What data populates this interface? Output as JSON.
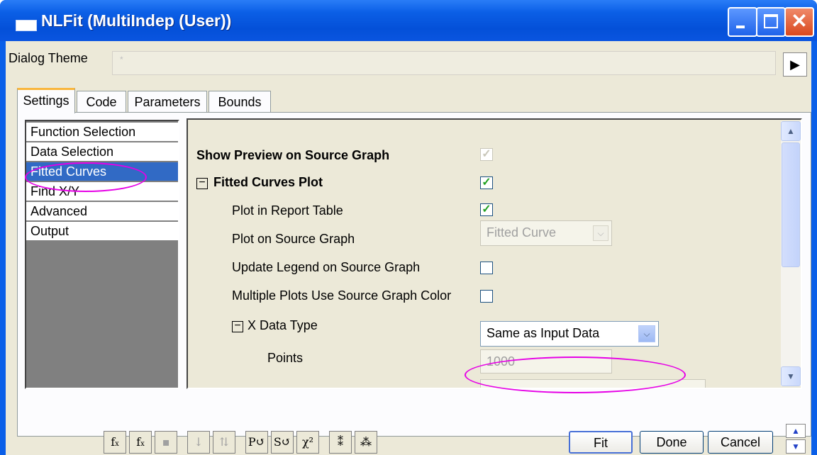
{
  "window": {
    "title": "NLFit (MultiIndep (User))"
  },
  "theme": {
    "label": "Dialog Theme",
    "value": "*"
  },
  "tabs": [
    "Settings",
    "Code",
    "Parameters",
    "Bounds"
  ],
  "nav": {
    "items": [
      "Function Selection",
      "Data Selection",
      "Fitted Curves",
      "Find X/Y",
      "Advanced",
      "Output"
    ],
    "selected": 2
  },
  "settings": {
    "show_preview": {
      "label": "Show Preview on Source Graph",
      "checked": true,
      "enabled": false
    },
    "fitted_curves_plot": {
      "label": "Fitted Curves Plot",
      "checked": true
    },
    "plot_in_report": {
      "label": "Plot in Report Table",
      "checked": true
    },
    "plot_on_source": {
      "label": "Plot on Source Graph",
      "value": "Fitted Curve"
    },
    "update_legend": {
      "label": "Update Legend on Source Graph",
      "checked": false
    },
    "multiple_plots": {
      "label": "Multiple Plots Use Source Graph Color",
      "checked": false
    },
    "x_data_type": {
      "label": "X Data Type",
      "value": "Same as Input Data"
    },
    "points": {
      "label": "Points",
      "value": "1000"
    }
  },
  "toolbar": {
    "icons": [
      "fit-function-icon",
      "function-icon",
      "save-icon",
      "sort-down-icon",
      "sort-params-icon",
      "p-arrow-icon",
      "s-arrow-icon",
      "chi-square-icon",
      "iterate-icon",
      "iterate-fast-icon"
    ],
    "chi": "χ²"
  },
  "buttons": {
    "fit": "Fit",
    "done": "Done",
    "cancel": "Cancel"
  },
  "colors": {
    "title_blue": "#0450d8",
    "highlight": "#e600e6",
    "selection": "#316ac5",
    "check_green": "#21a121"
  }
}
